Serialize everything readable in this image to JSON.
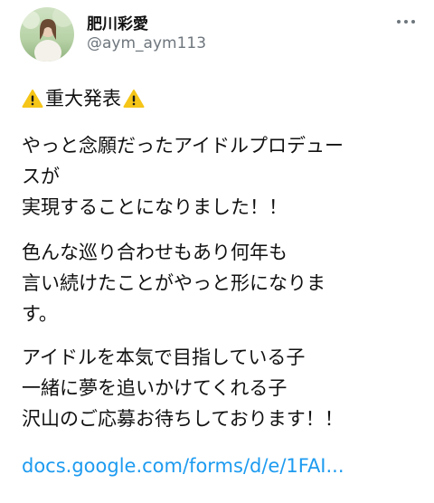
{
  "author": {
    "display_name": "肥川彩愛",
    "handle": "@aym_aym113",
    "avatar_icon": "profile-photo-avatar"
  },
  "more_icon": "more-dots-icon",
  "tweet": {
    "headline": {
      "text": "重大発表",
      "icon": "warning-icon"
    },
    "paragraphs": [
      {
        "lines": [
          "やっと念願だったアイドルプロデュー",
          "スが",
          "実現することになりました！！"
        ]
      },
      {
        "lines": [
          "色んな巡り合わせもあり何年も",
          "言い続けたことがやっと形になりま",
          "す。"
        ]
      },
      {
        "lines": [
          "アイドルを本気で目指している子",
          "一緒に夢を追いかけてくれる子",
          "沢山のご応募お待ちしております！！"
        ]
      }
    ],
    "link": "docs.google.com/forms/d/e/1FAI..."
  },
  "colors": {
    "link": "#1d9bf0",
    "handle": "#6e767d",
    "text": "#111111",
    "warning": "#f5c518"
  }
}
